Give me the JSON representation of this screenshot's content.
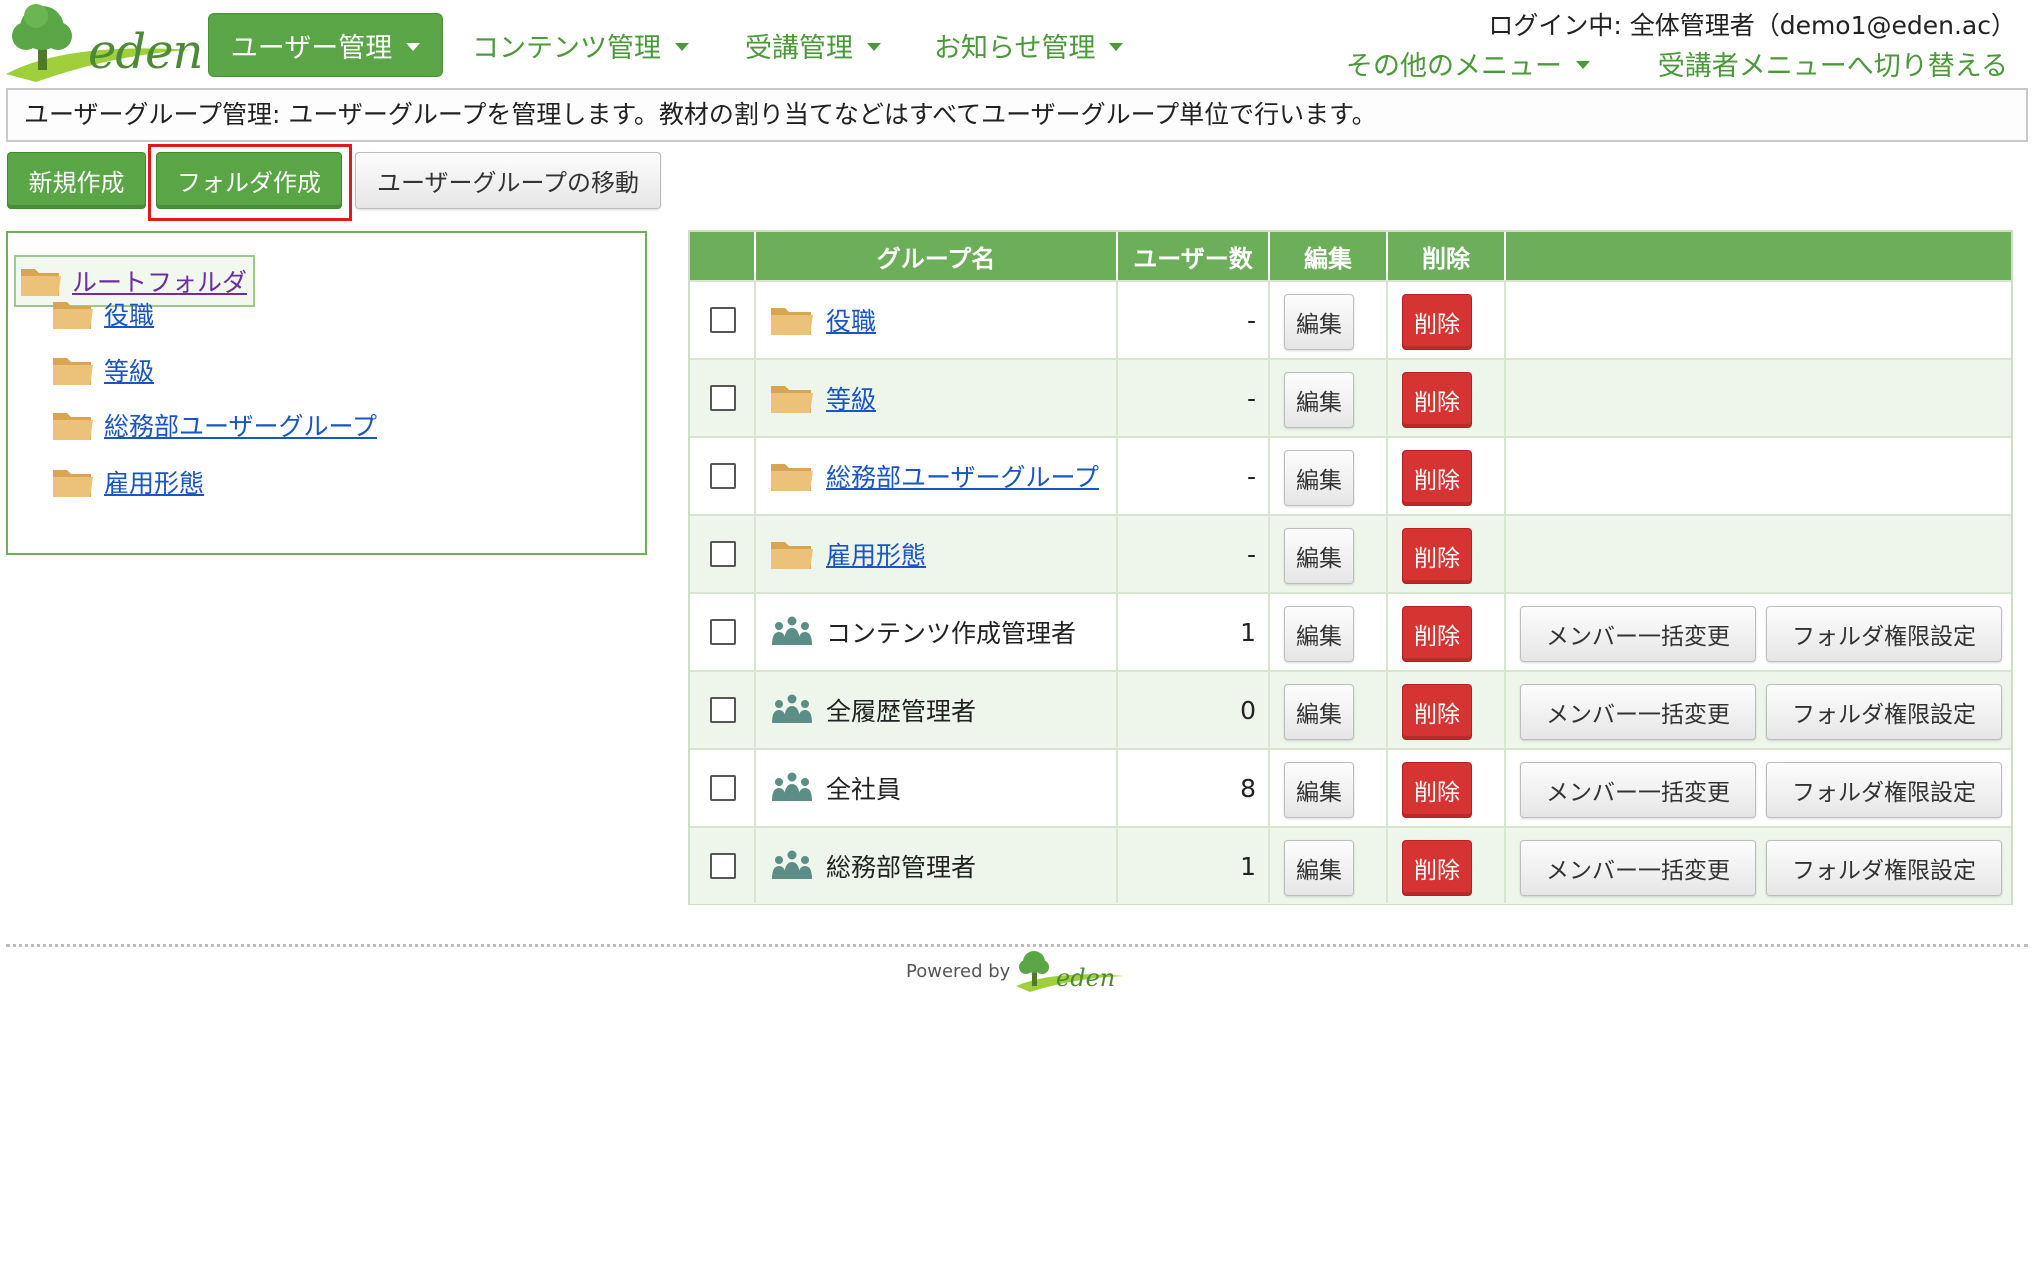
{
  "brand": {
    "logo_text": "eden",
    "colors": {
      "primary_green": "#5aa646",
      "delete_red": "#d63333",
      "link_blue": "#1a55c4",
      "folder_tan": "#e8b86a",
      "group_teal": "#5c8d86"
    }
  },
  "nav": {
    "items": [
      {
        "label": "ユーザー管理",
        "active": true
      },
      {
        "label": "コンテンツ管理"
      },
      {
        "label": "受講管理"
      },
      {
        "label": "お知らせ管理"
      }
    ],
    "login_info": "ログイン中: 全体管理者（demo1@eden.ac）",
    "other_menu": "その他のメニュー",
    "switch_menu": "受講者メニューへ切り替える"
  },
  "description": "ユーザーグループ管理: ユーザーグループを管理します。教材の割り当てなどはすべてユーザーグループ単位で行います。",
  "actions": {
    "new": "新規作成",
    "create_folder": "フォルダ作成",
    "move": "ユーザーグループの移動"
  },
  "tree": {
    "root": "ルートフォルダ",
    "children": [
      "役職",
      "等級",
      "総務部ユーザーグループ",
      "雇用形態"
    ]
  },
  "table": {
    "headers": {
      "name": "グループ名",
      "users": "ユーザー数",
      "edit": "編集",
      "delete": "削除"
    },
    "edit_label": "編集",
    "delete_label": "削除",
    "bulk_member_label": "メンバー一括変更",
    "folder_perm_label": "フォルダ権限設定",
    "rows": [
      {
        "type": "folder",
        "name": "役職",
        "count": "-"
      },
      {
        "type": "folder",
        "name": "等級",
        "count": "-"
      },
      {
        "type": "folder",
        "name": "総務部ユーザーグループ",
        "count": "-"
      },
      {
        "type": "folder",
        "name": "雇用形態",
        "count": "-"
      },
      {
        "type": "group",
        "name": "コンテンツ作成管理者",
        "count": "1"
      },
      {
        "type": "group",
        "name": "全履歴管理者",
        "count": "0"
      },
      {
        "type": "group",
        "name": "全社員",
        "count": "8"
      },
      {
        "type": "group",
        "name": "総務部管理者",
        "count": "1"
      }
    ]
  },
  "footer": {
    "powered_by": "Powered by",
    "logo_text": "eden"
  }
}
